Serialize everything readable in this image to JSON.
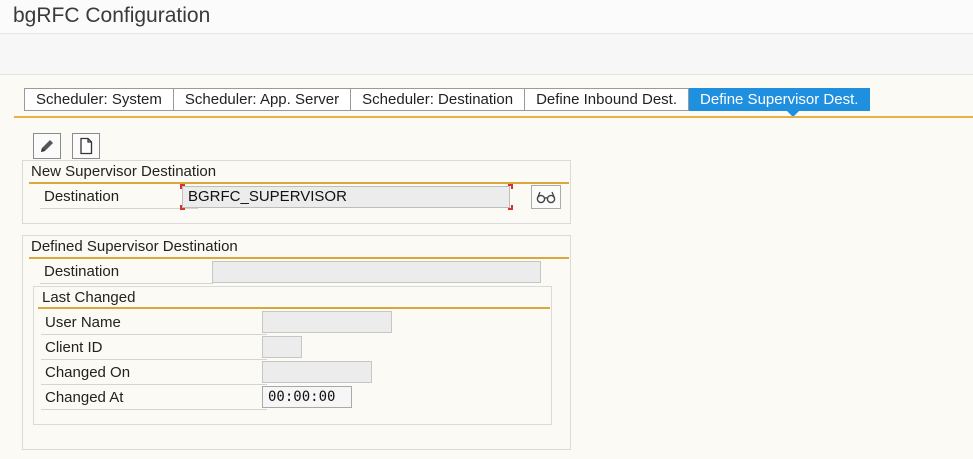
{
  "window": {
    "title": "bgRFC Configuration"
  },
  "tabs": [
    {
      "label": "Scheduler: System"
    },
    {
      "label": "Scheduler: App. Server"
    },
    {
      "label": "Scheduler: Destination"
    },
    {
      "label": "Define Inbound Dest."
    },
    {
      "label": "Define Supervisor Dest.",
      "active": true
    }
  ],
  "toolbar": {
    "edit_icon": "pencil-icon",
    "new_icon": "document-icon"
  },
  "new_group": {
    "title": "New Supervisor Destination",
    "destination_label": "Destination",
    "destination_value": "BGRFC_SUPERVISOR",
    "display_icon": "glasses-icon"
  },
  "defined_group": {
    "title": "Defined Supervisor Destination",
    "destination_label": "Destination",
    "destination_value": "",
    "last_changed": {
      "title": "Last Changed",
      "user_name_label": "User Name",
      "user_name_value": "",
      "client_id_label": "Client ID",
      "client_id_value": "",
      "changed_on_label": "Changed On",
      "changed_on_value": "",
      "changed_at_label": "Changed At",
      "changed_at_value": "00:00:00"
    }
  },
  "colors": {
    "accent": "#1f8fe0",
    "section_line": "#d9a73a",
    "background": "#fcfaf4"
  }
}
